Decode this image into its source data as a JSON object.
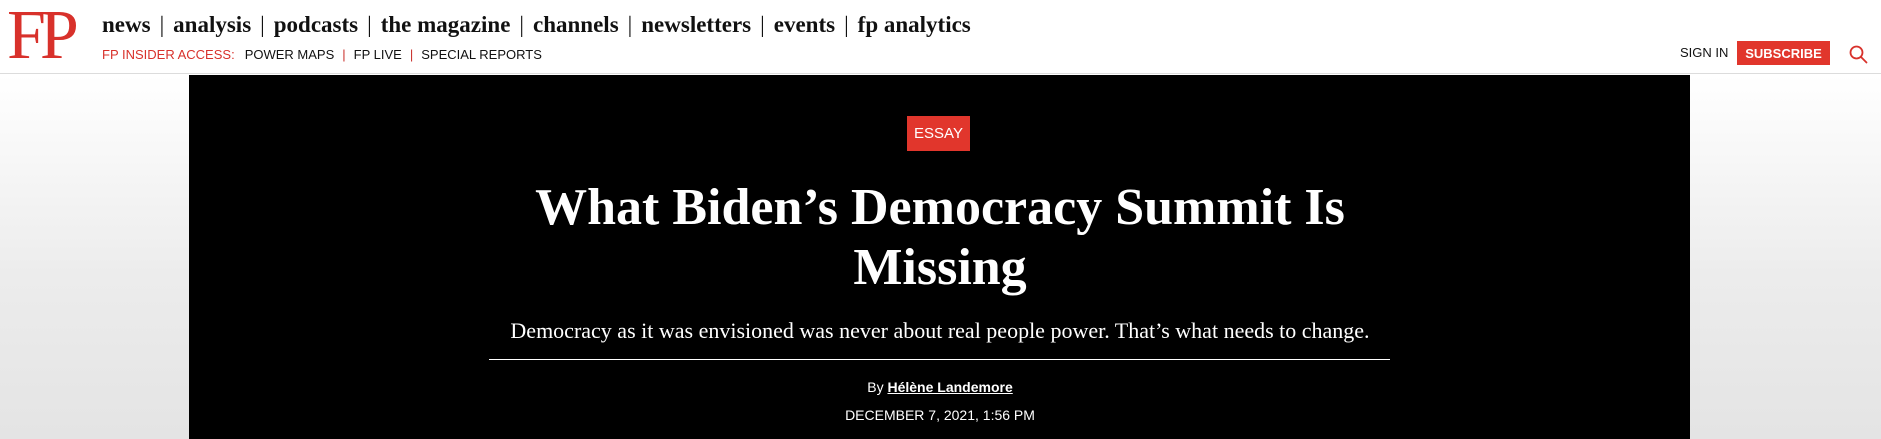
{
  "header": {
    "logo": "FP",
    "nav": [
      "news",
      "analysis",
      "podcasts",
      "the magazine",
      "channels",
      "newsletters",
      "events",
      "fp analytics"
    ],
    "insider_label": "FP INSIDER ACCESS:",
    "insider_links": [
      "POWER MAPS",
      "FP LIVE",
      "SPECIAL REPORTS"
    ],
    "signin": "SIGN IN",
    "subscribe": "SUBSCRIBE"
  },
  "article": {
    "category": "ESSAY",
    "title": "What Biden’s Democracy Summit Is Missing",
    "dek": "Democracy as it was envisioned was never about real people power. That’s what needs to change.",
    "byline_prefix": "By",
    "author": "Hélène Landemore",
    "date": "DECEMBER 7, 2021, 1:56 PM"
  },
  "colors": {
    "brand_red": "#d8312b",
    "subscribe_bg": "#e1362c",
    "hero_bg": "#000000"
  },
  "icons": {
    "search": "search-icon"
  }
}
